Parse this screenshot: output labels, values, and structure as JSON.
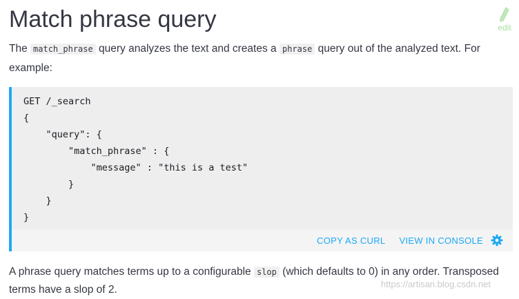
{
  "heading": "Match phrase query",
  "edit_label": "edit",
  "intro": {
    "p1": "The ",
    "code1": "match_phrase",
    "p2": " query analyzes the text and creates a ",
    "code2": "phrase",
    "p3": " query out of the analyzed text. For example:"
  },
  "code_block": "GET /_search\n{\n    \"query\": {\n        \"match_phrase\" : {\n            \"message\" : \"this is a test\"\n        }\n    }\n}",
  "actions": {
    "copy_as_curl": "COPY AS CURL",
    "view_in_console": "VIEW IN CONSOLE"
  },
  "outro": {
    "p1": "A phrase query matches terms up to a configurable ",
    "code": "slop",
    "p2": " (which defaults to 0) in any order. Transposed terms have a slop of 2."
  },
  "watermark": "https://artisan.blog.csdn.net",
  "colors": {
    "accent": "#1ba9f5",
    "edit": "#a8dca0",
    "code_bg": "#eeeeef"
  }
}
